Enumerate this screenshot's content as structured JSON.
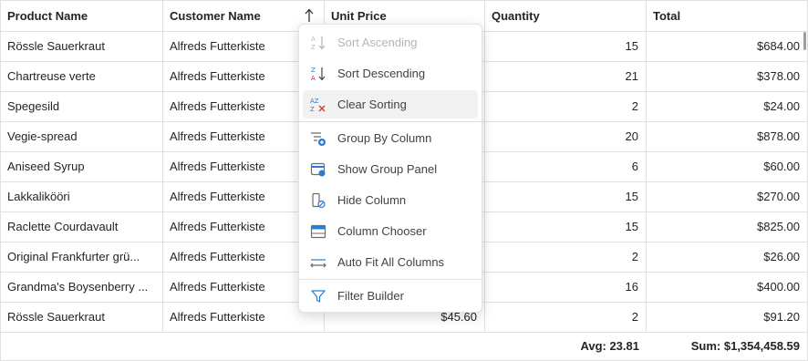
{
  "columns": [
    {
      "label": "Product Name"
    },
    {
      "label": "Customer Name"
    },
    {
      "label": "Unit Price"
    },
    {
      "label": "Quantity"
    },
    {
      "label": "Total"
    }
  ],
  "rows": [
    {
      "product": "Rössle Sauerkraut",
      "customer": "Alfreds Futterkiste",
      "unit_price": "",
      "quantity": "15",
      "total": "$684.00"
    },
    {
      "product": "Chartreuse verte",
      "customer": "Alfreds Futterkiste",
      "unit_price": "",
      "quantity": "21",
      "total": "$378.00"
    },
    {
      "product": "Spegesild",
      "customer": "Alfreds Futterkiste",
      "unit_price": "",
      "quantity": "2",
      "total": "$24.00"
    },
    {
      "product": "Vegie-spread",
      "customer": "Alfreds Futterkiste",
      "unit_price": "",
      "quantity": "20",
      "total": "$878.00"
    },
    {
      "product": "Aniseed Syrup",
      "customer": "Alfreds Futterkiste",
      "unit_price": "",
      "quantity": "6",
      "total": "$60.00"
    },
    {
      "product": "Lakkalikööri",
      "customer": "Alfreds Futterkiste",
      "unit_price": "",
      "quantity": "15",
      "total": "$270.00"
    },
    {
      "product": "Raclette Courdavault",
      "customer": "Alfreds Futterkiste",
      "unit_price": "",
      "quantity": "15",
      "total": "$825.00"
    },
    {
      "product": "Original Frankfurter grü...",
      "customer": "Alfreds Futterkiste",
      "unit_price": "",
      "quantity": "2",
      "total": "$26.00"
    },
    {
      "product": "Grandma's Boysenberry ...",
      "customer": "Alfreds Futterkiste",
      "unit_price": "",
      "quantity": "16",
      "total": "$400.00"
    },
    {
      "product": "Rössle Sauerkraut",
      "customer": "Alfreds Futterkiste",
      "unit_price": "$45.60",
      "quantity": "2",
      "total": "$91.20"
    }
  ],
  "footer": {
    "quantity_summary": "Avg: 23.81",
    "total_summary": "Sum: $1,354,458.59"
  },
  "context_menu": {
    "items": [
      {
        "label": "Sort Ascending",
        "icon": "sort-ascending-icon",
        "disabled": true
      },
      {
        "label": "Sort Descending",
        "icon": "sort-descending-icon",
        "disabled": false
      },
      {
        "label": "Clear Sorting",
        "icon": "clear-sorting-icon",
        "disabled": false,
        "active": true
      },
      {
        "label": "Group By Column",
        "icon": "group-by-column-icon",
        "disabled": false
      },
      {
        "label": "Show Group Panel",
        "icon": "group-panel-icon",
        "disabled": false
      },
      {
        "label": "Hide Column",
        "icon": "hide-column-icon",
        "disabled": false
      },
      {
        "label": "Column Chooser",
        "icon": "column-chooser-icon",
        "disabled": false
      },
      {
        "label": "Auto Fit All Columns",
        "icon": "auto-fit-icon",
        "disabled": false
      },
      {
        "label": "Filter Builder",
        "icon": "filter-icon",
        "disabled": false
      }
    ]
  },
  "colors": {
    "accent_blue": "#2b7cd3",
    "accent_red": "#d13438",
    "border": "#e0e0e0",
    "hover": "#f2f2f2"
  }
}
